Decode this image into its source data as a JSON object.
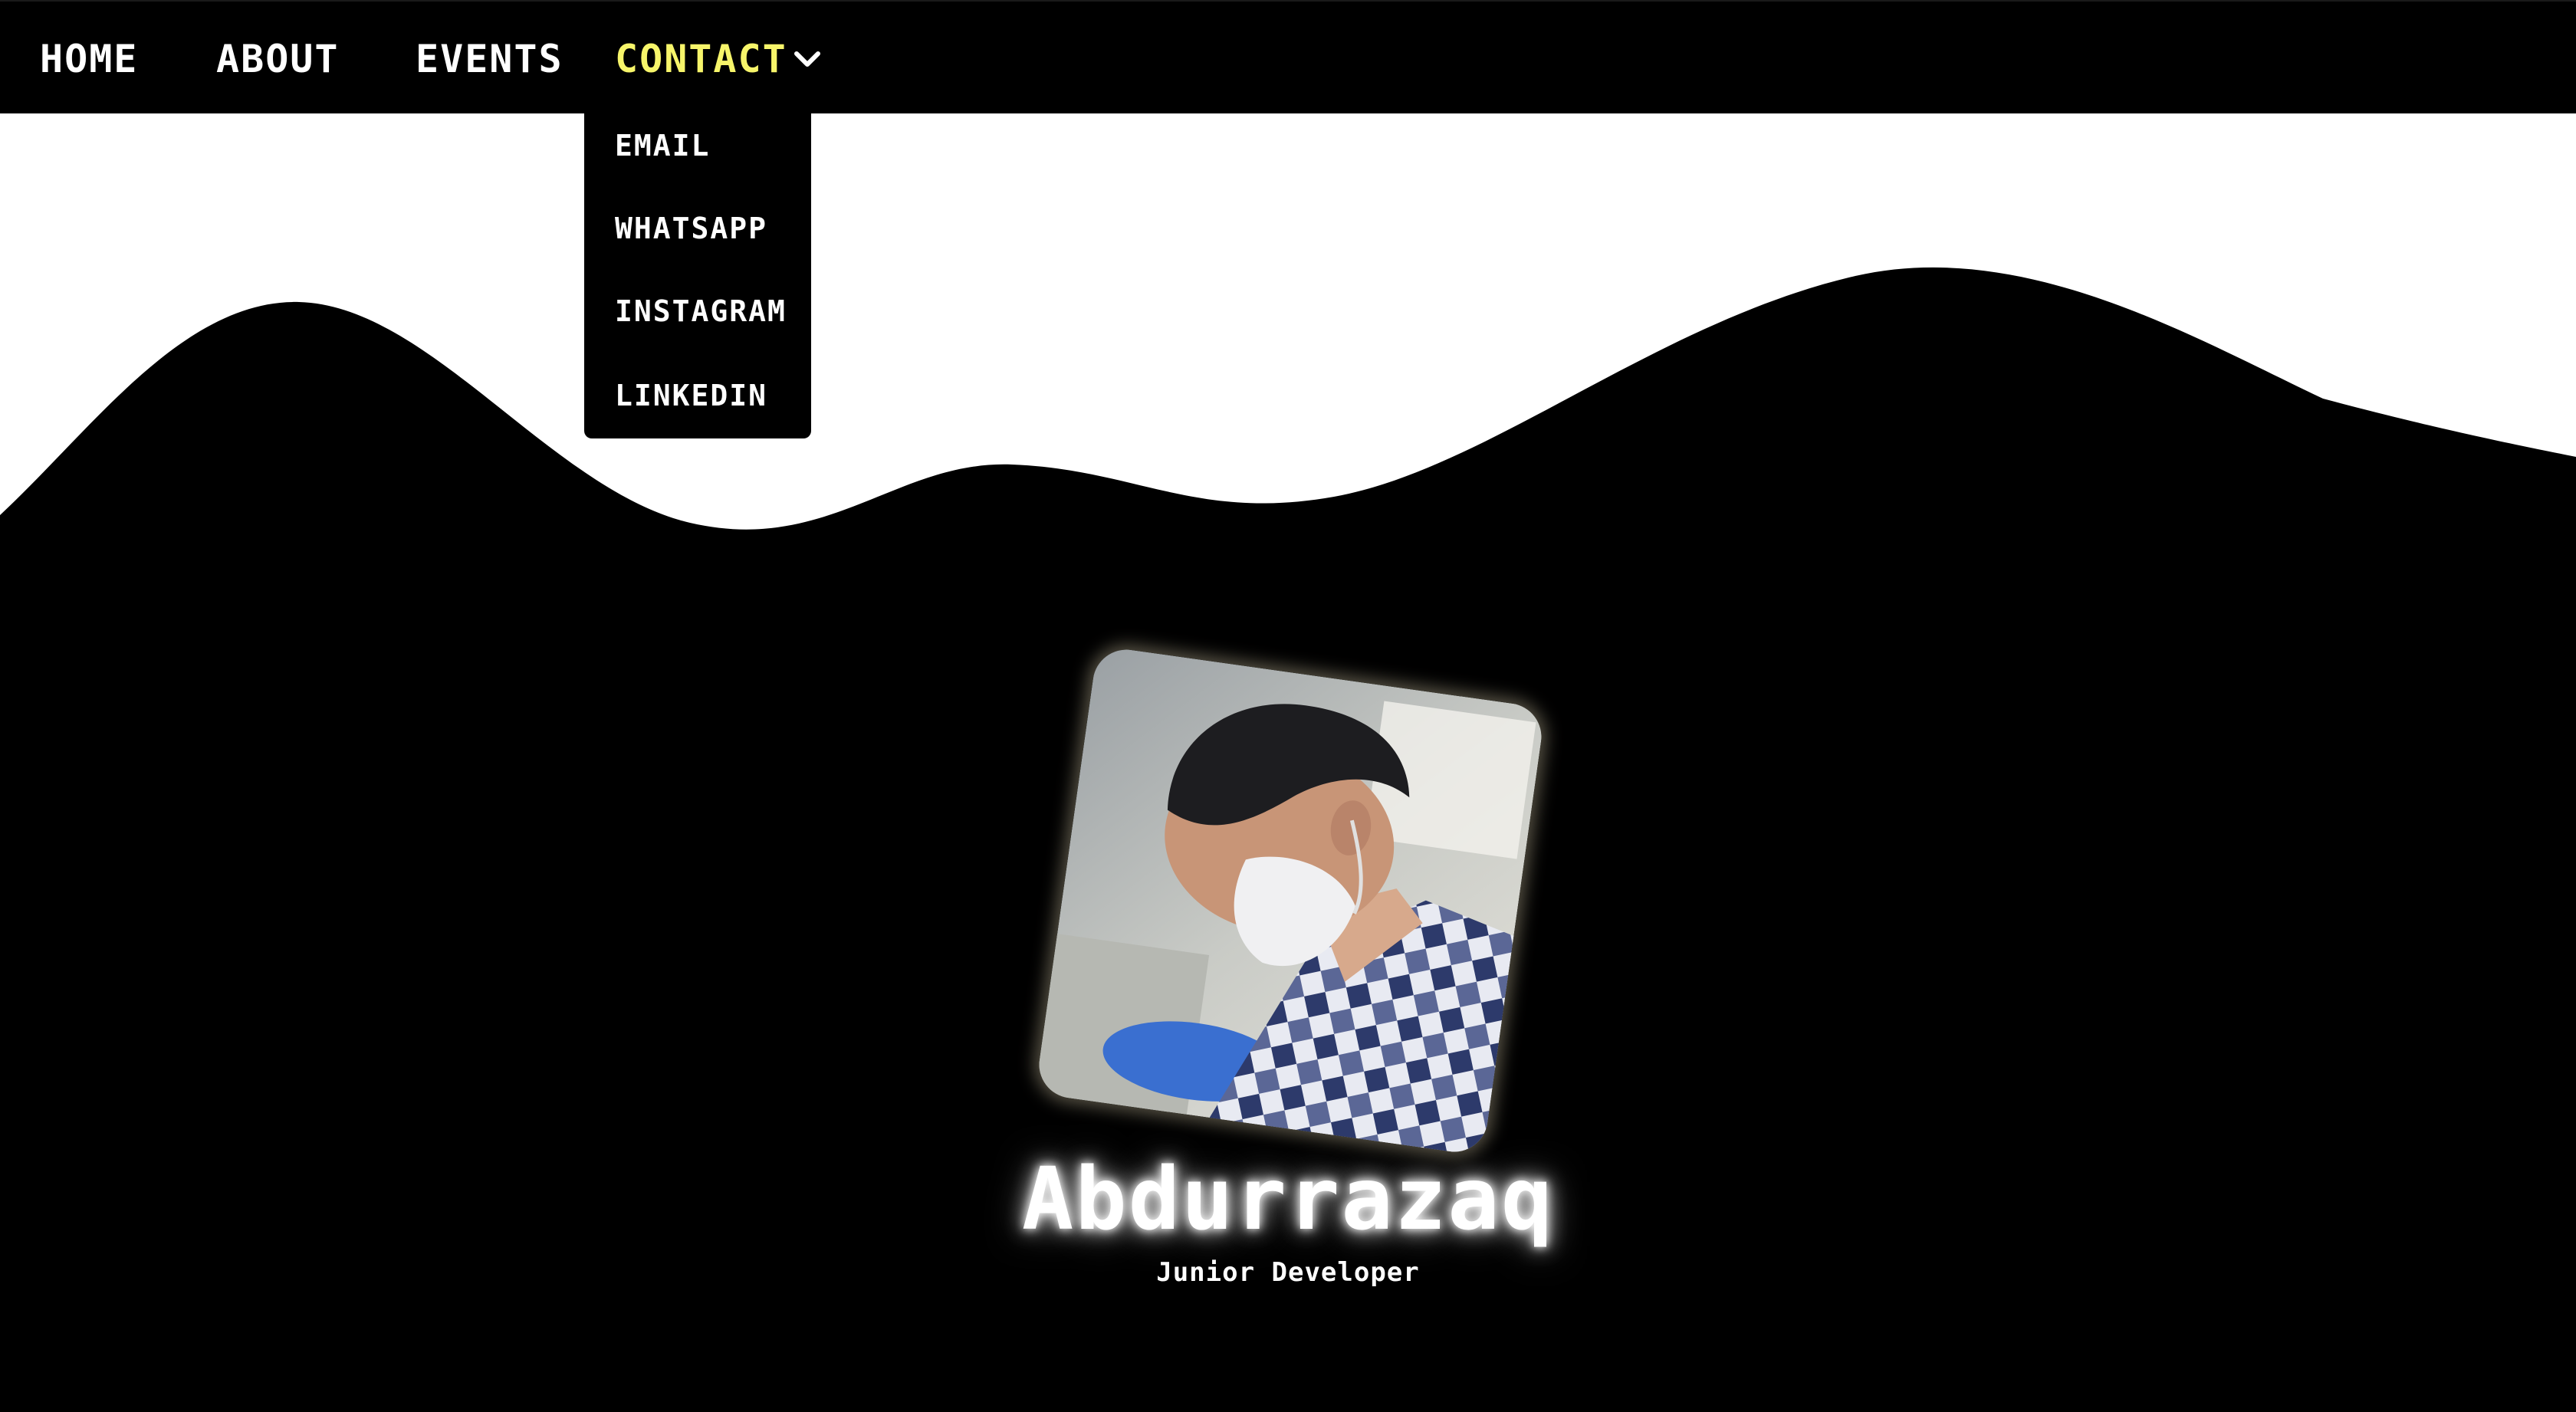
{
  "nav": {
    "home": "HOME",
    "about": "ABOUT",
    "events": "EVENTS",
    "contact": "CONTACT"
  },
  "contact_menu": {
    "email": "EMAIL",
    "whatsapp": "WHATSAPP",
    "instagram": "INSTAGRAM",
    "linkedin": "LINKEDIN"
  },
  "profile": {
    "name": "Abdurrazaq",
    "role": "Junior Developer"
  },
  "colors": {
    "background": "#000000",
    "accent": "#f7f56a",
    "text": "#ffffff"
  },
  "icons": {
    "contact_toggle": "chevron-down-icon"
  }
}
